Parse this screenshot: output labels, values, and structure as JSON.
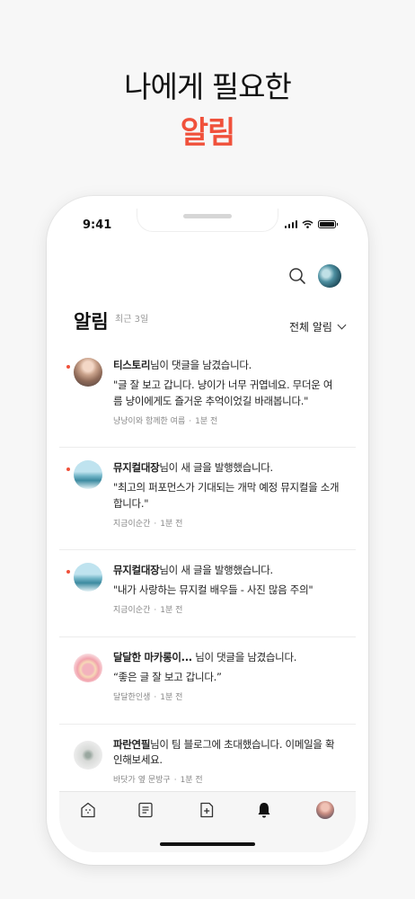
{
  "promo": {
    "line1": "나에게 필요한",
    "line2": "알림",
    "accent_color": "#f0513b"
  },
  "status_bar": {
    "time": "9:41"
  },
  "header": {
    "search_icon": "search-icon",
    "profile_icon": "profile-avatar"
  },
  "page": {
    "title": "알림",
    "subtitle": "최근 3일",
    "filter_label": "전체 알림"
  },
  "notifications": [
    {
      "unread": true,
      "name": "티스토리",
      "action": "님이 댓글을 남겼습니다.",
      "message": "\"글 잘 보고 갑니다. 냥이가 너무 귀엽네요. 무더운 여름 냥이에게도 즐거운 추억이었길 바래봅니다.\"",
      "blog": "냥냥이와 함께한 여름",
      "time": "1분 전"
    },
    {
      "unread": true,
      "name": "뮤지컬대장",
      "action": "님이 새 글을 발행했습니다.",
      "message": "\"최고의 퍼포먼스가 기대되는 개막 예정 뮤지컬을 소개합니다.\"",
      "blog": "지금이순간",
      "time": "1분 전"
    },
    {
      "unread": true,
      "name": "뮤지컬대장",
      "action": "님이 새 글을 발행했습니다.",
      "message": "\"내가 사랑하는 뮤지컬 배우들 - 사진 많음 주의\"",
      "blog": "지금이순간",
      "time": "1분 전"
    },
    {
      "unread": false,
      "name": "달달한 마카롱이...",
      "action": " 님이 댓글을 남겼습니다.",
      "message": "“좋은 글 잘 보고 갑니다.”",
      "blog": "달달한인생",
      "time": "1분 전"
    },
    {
      "unread": false,
      "name": "파란연필",
      "action": "님이 팀 블로그에 초대했습니다. 이메일을 확인해보세요.",
      "message": "",
      "blog": "바닷가 옆 문방구",
      "time": "1분 전"
    }
  ],
  "tabbar": {
    "items": [
      "home-icon",
      "document-icon",
      "new-post-icon",
      "bell-icon",
      "profile-avatar"
    ],
    "active": "bell-icon"
  }
}
